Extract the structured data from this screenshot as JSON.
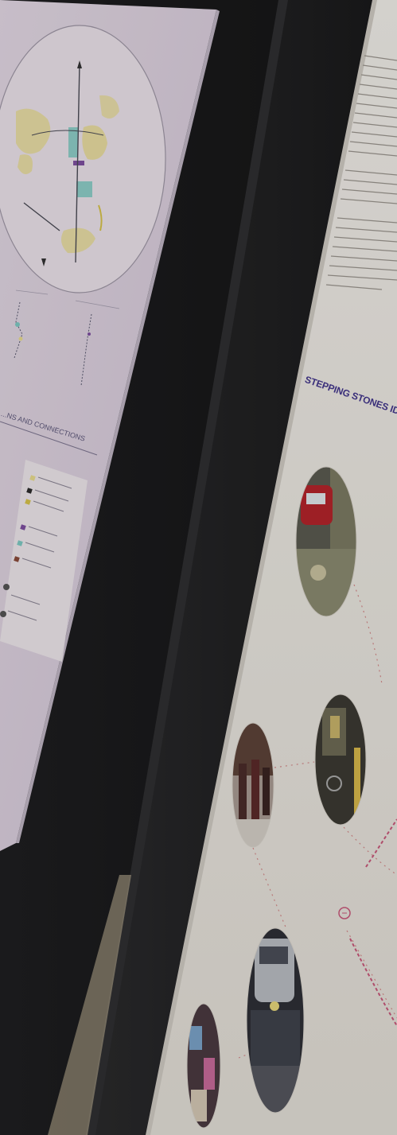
{
  "left_board": {
    "section_heading": "...NS AND CONNECTIONS"
  },
  "right_board": {
    "heading": "STEPPING STONES IDEAS...",
    "photos": [
      "red-car-street-photo",
      "pedestrians-crossing-photo",
      "cyclist-street-photo",
      "car-parked-street-photo",
      "shopfront-signage-photo"
    ]
  },
  "colors": {
    "background": "#1b1b1c",
    "left_board": "#ddd2df",
    "right_board": "#ece9e3",
    "heading_text": "#3a2f7a",
    "map_yellow": "#e8db8e",
    "map_teal": "#7ec9c2",
    "map_purple": "#7e4fa0",
    "route_red": "#c8587a"
  }
}
